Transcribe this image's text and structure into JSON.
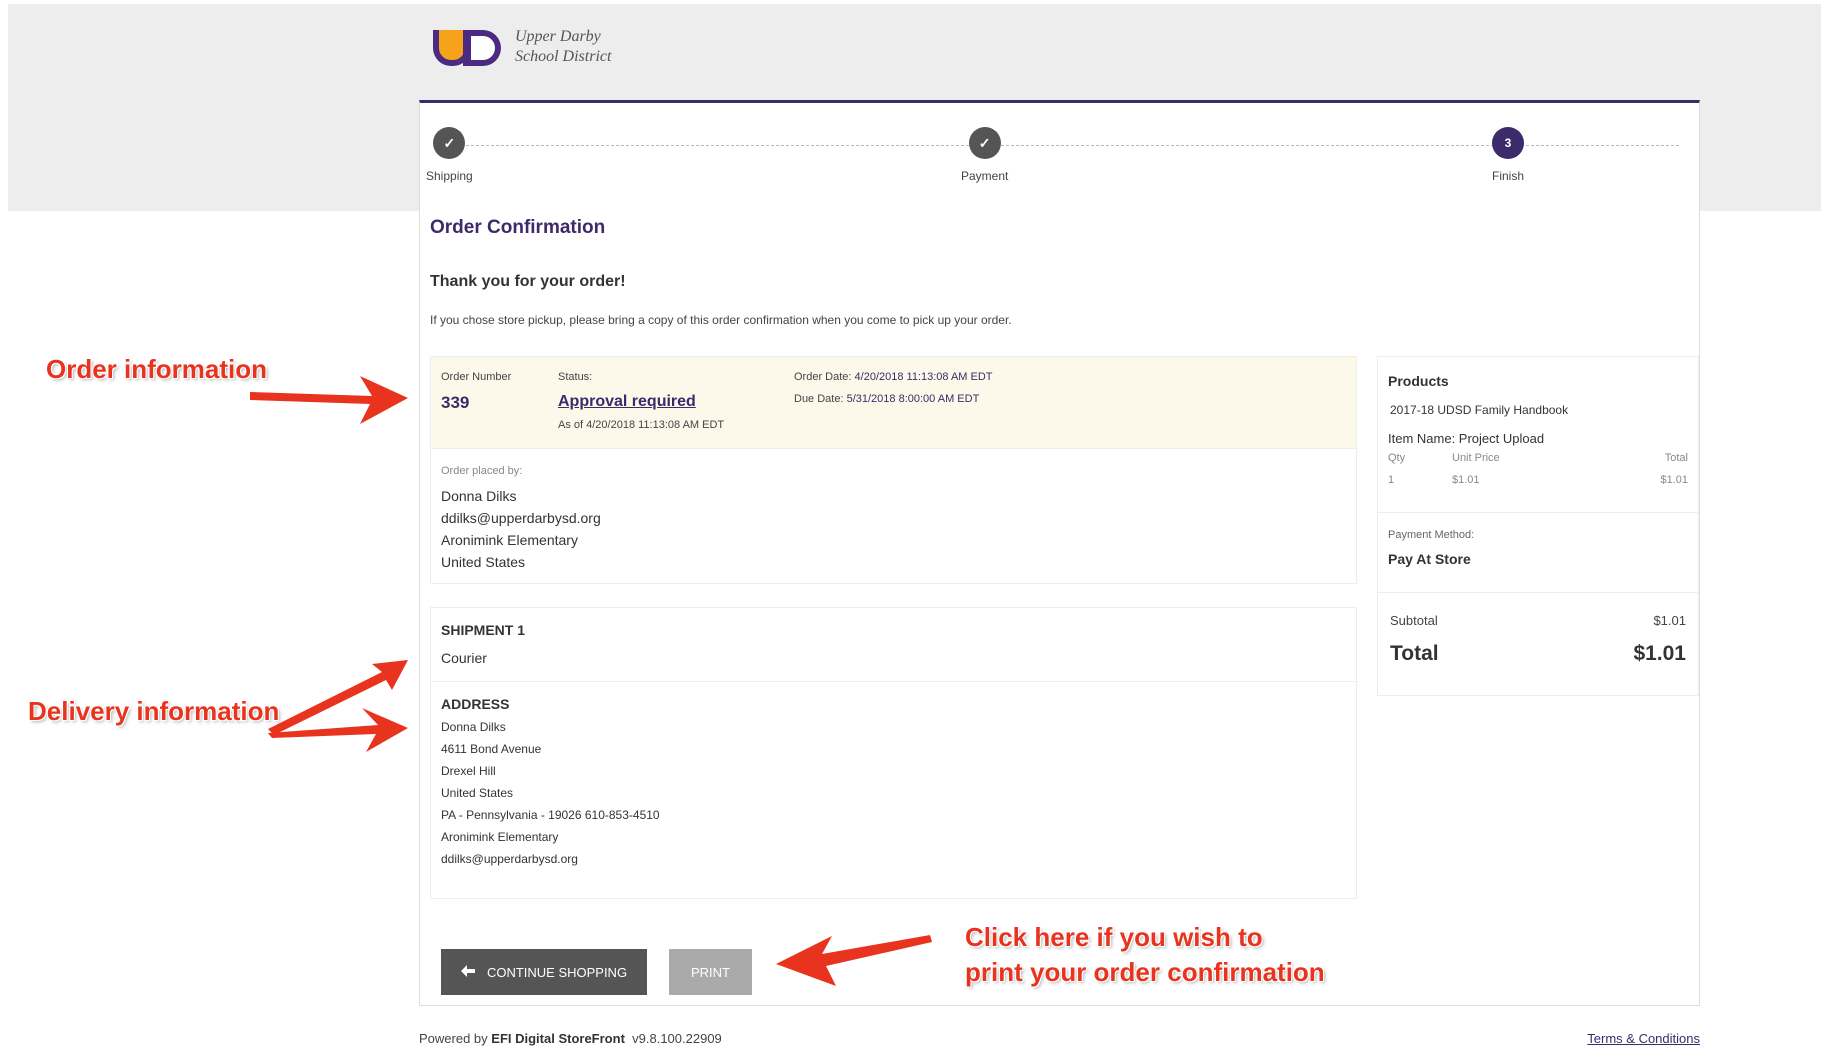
{
  "logo": {
    "line1": "Upper Darby",
    "line2": "School District"
  },
  "stepper": {
    "steps": [
      {
        "label": "Shipping",
        "state": "done",
        "marker": "✓"
      },
      {
        "label": "Payment",
        "state": "done",
        "marker": "✓"
      },
      {
        "label": "Finish",
        "state": "active",
        "marker": "3"
      }
    ]
  },
  "page": {
    "heading": "Order Confirmation",
    "thanks": "Thank you for your order!",
    "note": "If you chose store pickup, please bring a copy of this order confirmation when you come to pick up your order."
  },
  "order": {
    "number_label": "Order Number",
    "number": "339",
    "status_label": "Status:",
    "status": "Approval required",
    "as_of": "As of 4/20/2018 11:13:08 AM EDT",
    "order_date_label": "Order Date:",
    "order_date": "4/20/2018 11:13:08 AM EDT",
    "due_date_label": "Due Date:",
    "due_date": "5/31/2018 8:00:00 AM EDT"
  },
  "placed_by": {
    "label": "Order placed by:",
    "name": "Donna Dilks",
    "email": "ddilks@upperdarbysd.org",
    "school": "Aronimink Elementary",
    "country": "United States"
  },
  "shipment": {
    "title": "SHIPMENT 1",
    "method": "Courier",
    "address_title": "ADDRESS",
    "address_lines": [
      "Donna Dilks",
      "4611 Bond Avenue",
      "Drexel Hill",
      "United States",
      "PA - Pennsylvania - 19026 610-853-4510",
      "Aronimink Elementary",
      "ddilks@upperdarbysd.org"
    ]
  },
  "summary": {
    "products_label": "Products",
    "product_name": "2017-18 UDSD Family Handbook",
    "item_name": "Item Name: Project Upload",
    "qty_header": "Qty",
    "unit_price_header": "Unit Price",
    "total_header": "Total",
    "qty": "1",
    "unit_price": "$1.01",
    "line_total": "$1.01",
    "payment_method_label": "Payment Method:",
    "payment_method": "Pay At Store",
    "subtotal_label": "Subtotal",
    "subtotal": "$1.01",
    "total_label": "Total",
    "total": "$1.01"
  },
  "buttons": {
    "continue": "CONTINUE SHOPPING",
    "print": "PRINT"
  },
  "footer": {
    "powered_by": "Powered by",
    "brand": "EFI Digital StoreFront",
    "version": "v9.8.100.22909",
    "terms": "Terms & Conditions"
  },
  "annotations": {
    "order_info": "Order information",
    "delivery_info": "Delivery information",
    "print_line1": "Click here if you wish to",
    "print_line2": "print your order confirmation"
  },
  "colors": {
    "accent": "#3c2a6b",
    "annotation": "#e8341e",
    "order_bg": "#fcf9ea"
  }
}
